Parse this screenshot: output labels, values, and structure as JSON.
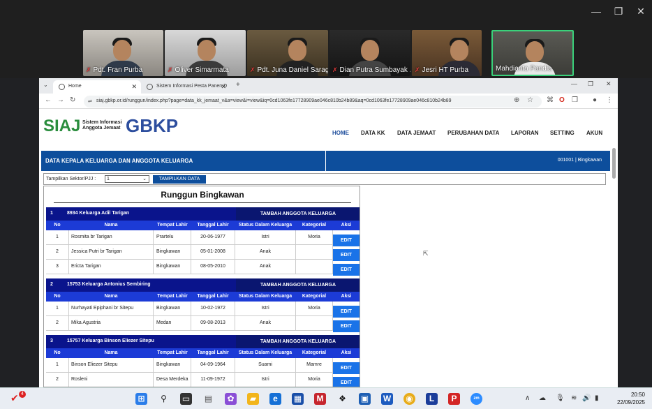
{
  "meeting": {
    "participants": [
      {
        "name": "Pdt. Fran Purba"
      },
      {
        "name": "Oliver Simarmata"
      },
      {
        "name": "Pdt. Juna Daniel Saragih"
      },
      {
        "name": "Dian Putra Sumbayak ..."
      },
      {
        "name": "Jesri HT Purba"
      },
      {
        "name": "Mahdianta Pandia"
      }
    ]
  },
  "browser": {
    "tabs": [
      {
        "label": "Home"
      },
      {
        "label": "Sistem Informasi Pesta Panen D"
      }
    ],
    "url": "siaj.gbkp.or.id/runggun/index.php?page=data_kk_jemaat_v&a=view&i=view&iq=0cd1063fe17728909ae046c810b24b89&aq=0cd1063fe17728909ae046c810b24b89"
  },
  "site": {
    "logo_main": "SIAJ",
    "logo_sub_1": "Sistem Informasi",
    "logo_sub_2": "Anggota Jemaat",
    "logo_brand": "GBKP",
    "menu": [
      "HOME",
      "DATA KK",
      "DATA JEMAAT",
      "PERUBAHAN DATA",
      "LAPORAN",
      "SETTING",
      "AKUN"
    ]
  },
  "page": {
    "title": "DATA KEPALA KELUARGA DAN ANGGOTA KELUARGA",
    "runggun_code": "001001 | Bingkawan",
    "filter_label": "Tampilkan Sektor/PJJ :",
    "filter_value": "1",
    "show_button": "TAMPILKAN DATA",
    "runggun_title": "Runggun Bingkawan",
    "add_member": "TAMBAH ANGGOTA KELUARGA",
    "edit_label": "EDIT",
    "columns": [
      "No",
      "Nama",
      "Tempat Lahir",
      "Tanggal Lahir",
      "Status Dalam Keluarga",
      "Kategorial",
      "Aksi"
    ],
    "families": [
      {
        "no": "1",
        "name": "8934 Keluarga Adil Tarigan",
        "members": [
          {
            "no": "1",
            "nama": "Rosmita br Tarigan",
            "tempat": "Prartelu",
            "tanggal": "20-06-1977",
            "status": "Istri",
            "kategorial": "Moria"
          },
          {
            "no": "2",
            "nama": "Jessica Putri br Tarigan",
            "tempat": "Bingkawan",
            "tanggal": "05-01-2008",
            "status": "Anak",
            "kategorial": ""
          },
          {
            "no": "3",
            "nama": "Ericta Tarigan",
            "tempat": "Bingkawan",
            "tanggal": "08-05-2010",
            "status": "Anak",
            "kategorial": ""
          }
        ]
      },
      {
        "no": "2",
        "name": "15753 Keluarga Antonius Sembiring",
        "members": [
          {
            "no": "1",
            "nama": "Nurhayati Epiphani br Sitepu",
            "tempat": "Bingkawan",
            "tanggal": "10-02-1972",
            "status": "Istri",
            "kategorial": "Moria"
          },
          {
            "no": "2",
            "nama": "Mika Agustria",
            "tempat": "Medan",
            "tanggal": "09-08-2013",
            "status": "Anak",
            "kategorial": ""
          }
        ]
      },
      {
        "no": "3",
        "name": "15757 Keluarga Binson Eliezer Sitepu",
        "members": [
          {
            "no": "1",
            "nama": "Binson Eliezer Sitepu",
            "tempat": "Bingkawan",
            "tanggal": "04-09-1964",
            "status": "Suami",
            "kategorial": "Mamre"
          },
          {
            "no": "2",
            "nama": "Rosleni",
            "tempat": "Desa Merdeka",
            "tanggal": "11-09-1972",
            "status": "Istri",
            "kategorial": "Moria"
          }
        ]
      }
    ]
  },
  "taskbar": {
    "time": "20:50",
    "date": "22/09/2025",
    "notification_count": "4"
  }
}
